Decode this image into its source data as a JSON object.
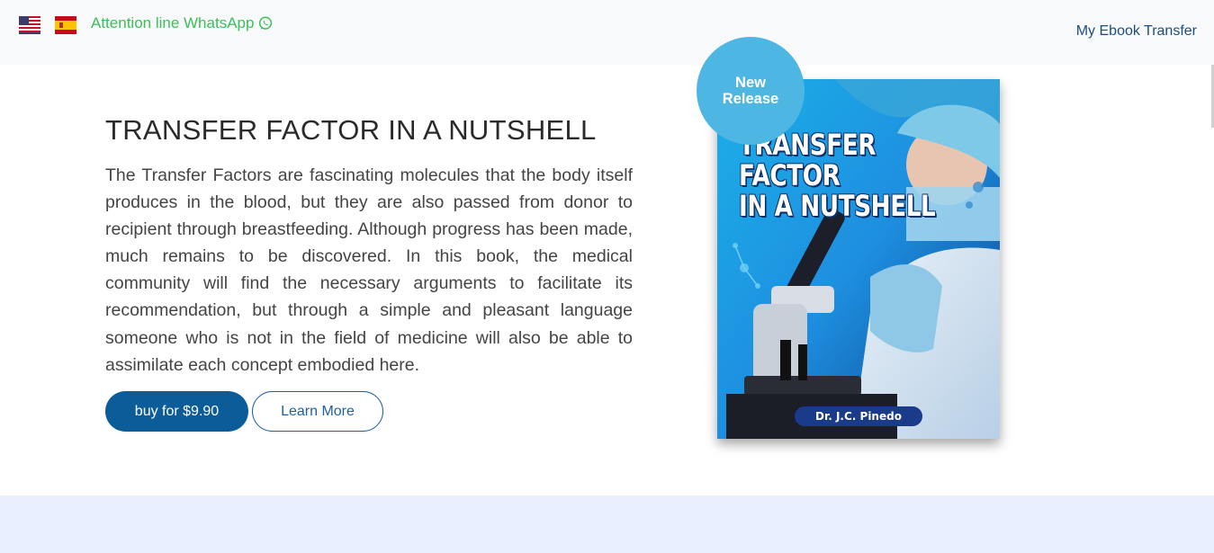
{
  "header": {
    "languages": [
      {
        "code": "en",
        "icon": "us-flag-icon"
      },
      {
        "code": "es",
        "icon": "spain-flag-icon"
      }
    ],
    "whatsapp_label": "Attention line WhatsApp",
    "whatsapp_icon": "whatsapp-icon",
    "nav_link": "My Ebook Transfer"
  },
  "hero": {
    "title": "TRANSFER FACTOR IN A NUTSHELL",
    "description": "The Transfer Factors are fascinating molecules that the body itself produces in the blood, but they are also passed from donor to recipient through breastfeeding. Although progress has been made, much remains to be discovered. In this book, the medical community will find the necessary arguments to facilitate its recommendation, but through a simple and pleasant language someone who is not in the field of medicine will also be able to assimilate each concept embodied here.",
    "buy_label": "buy for $9.90",
    "learn_more_label": "Learn More"
  },
  "book": {
    "badge_line1": "New",
    "badge_line2": "Release",
    "cover_title": "TRANSFER\nFACTOR\nIN A NUTSHELL",
    "cover_author": "Dr. J.C. Pinedo"
  },
  "colors": {
    "primary": "#0d5c9a",
    "whatsapp": "#3dbe58",
    "badge": "#4db6e2",
    "band": "#e8efff"
  }
}
